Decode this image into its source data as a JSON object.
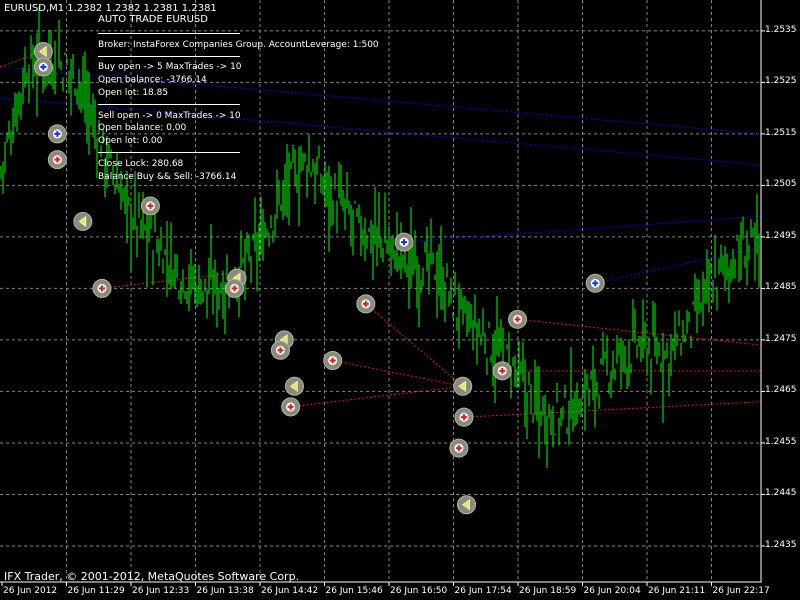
{
  "header": {
    "symbol_line": "EURUSD,M1  1.2382 1.2382 1.2381 1.2381",
    "ea_title": "AUTO TRADE EURUSD"
  },
  "info": {
    "broker": "Broker: InstaForex Companies Group. AccountLeverage: 1:500",
    "buy_open": "Buy open ->  5  MaxTrades ->  10",
    "buy_balance": "Open balance: -3766.14",
    "buy_lot": "Open lot: 18.85",
    "sell_open": "Sell open ->  0  MaxTrades ->  10",
    "sell_balance": "Open balance: 0.00",
    "sell_lot": "Open lot: 0.00",
    "close_lock": "Close Lock:  280.68",
    "balance_total": "Balance Buy && Sell: -3766.14"
  },
  "footer": "IFX Trader, © 2001-2012, MetaQuotes Software Corp.",
  "colors": {
    "background": "#000000",
    "grid": "#7f7f7f",
    "price_bars": "#00ff00",
    "buy_lines": "#0000ff",
    "sell_lines": "#ff0000",
    "text": "#ffffff"
  },
  "chart_data": {
    "type": "ohlc",
    "symbol": "EURUSD",
    "timeframe": "M1",
    "price_labels": [
      "1.2535",
      "1.2525",
      "1.2515",
      "1.2505",
      "1.2495",
      "1.2485",
      "1.2475",
      "1.2465",
      "1.2455",
      "1.2445",
      "1.2435"
    ],
    "time_labels": [
      "26 Jun 2012",
      "26 Jun 11:29",
      "26 Jun 12:33",
      "26 Jun 13:38",
      "26 Jun 14:42",
      "26 Jun 15:46",
      "26 Jun 16:50",
      "26 Jun 17:54",
      "26 Jun 18:59",
      "26 Jun 20:04",
      "26 Jun 21:11",
      "26 Jun 22:17"
    ],
    "ylim": [
      1.2428,
      1.2541
    ],
    "grid": true,
    "price_path": [
      [
        0,
        1.2508
      ],
      [
        2,
        1.2528
      ],
      [
        4,
        1.253
      ],
      [
        6,
        1.2526
      ],
      [
        8,
        1.2512
      ],
      [
        10,
        1.25
      ],
      [
        12,
        1.2494
      ],
      [
        14,
        1.2488
      ],
      [
        16,
        1.2485
      ],
      [
        18,
        1.2486
      ],
      [
        20,
        1.2492
      ],
      [
        22,
        1.2503
      ],
      [
        24,
        1.251
      ],
      [
        26,
        1.2503
      ],
      [
        28,
        1.2497
      ],
      [
        30,
        1.2494
      ],
      [
        32,
        1.249
      ],
      [
        34,
        1.2489
      ],
      [
        36,
        1.248
      ],
      [
        38,
        1.2475
      ],
      [
        40,
        1.247
      ],
      [
        42,
        1.2462
      ],
      [
        44,
        1.246
      ],
      [
        46,
        1.2465
      ],
      [
        48,
        1.247
      ],
      [
        50,
        1.2474
      ],
      [
        52,
        1.2472
      ],
      [
        54,
        1.2477
      ],
      [
        56,
        1.2487
      ],
      [
        58,
        1.2492
      ],
      [
        60,
        1.2494
      ],
      [
        62,
        1.2496
      ],
      [
        64,
        1.2487
      ],
      [
        66,
        1.247
      ],
      [
        68,
        1.2468
      ],
      [
        70,
        1.246
      ],
      [
        72,
        1.2448
      ],
      [
        74,
        1.2459
      ],
      [
        76,
        1.2466
      ],
      [
        78,
        1.2465
      ],
      [
        80,
        1.247
      ],
      [
        82,
        1.248
      ],
      [
        84,
        1.249
      ],
      [
        86,
        1.2497
      ],
      [
        88,
        1.2492
      ],
      [
        90,
        1.2495
      ],
      [
        92,
        1.249
      ],
      [
        94,
        1.2487
      ],
      [
        96,
        1.2485
      ],
      [
        98,
        1.2486
      ],
      [
        100,
        1.249
      ],
      [
        102,
        1.25
      ],
      [
        104,
        1.2495
      ],
      [
        106,
        1.2487
      ],
      [
        108,
        1.2493
      ],
      [
        110,
        1.2496
      ],
      [
        112,
        1.2495
      ],
      [
        114,
        1.2494
      ],
      [
        116,
        1.2495
      ]
    ],
    "markers": [
      {
        "t": 3.4,
        "p": 1.2531,
        "kind": "close"
      },
      {
        "t": 3.4,
        "p": 1.2528,
        "kind": "buy"
      },
      {
        "t": 4.5,
        "p": 1.2515,
        "kind": "buy"
      },
      {
        "t": 4.5,
        "p": 1.251,
        "kind": "sell"
      },
      {
        "t": 6.5,
        "p": 1.2498,
        "kind": "close"
      },
      {
        "t": 8.0,
        "p": 1.2485,
        "kind": "sell"
      },
      {
        "t": 11.8,
        "p": 1.2501,
        "kind": "sell"
      },
      {
        "t": 18.6,
        "p": 1.2487,
        "kind": "close"
      },
      {
        "t": 18.4,
        "p": 1.2485,
        "kind": "sell"
      },
      {
        "t": 22.3,
        "p": 1.2475,
        "kind": "close"
      },
      {
        "t": 22.0,
        "p": 1.2473,
        "kind": "sell"
      },
      {
        "t": 23.1,
        "p": 1.2466,
        "kind": "close"
      },
      {
        "t": 22.8,
        "p": 1.2462,
        "kind": "sell"
      },
      {
        "t": 26.1,
        "p": 1.2471,
        "kind": "sell"
      },
      {
        "t": 28.7,
        "p": 1.2482,
        "kind": "sell"
      },
      {
        "t": 31.7,
        "p": 1.2494,
        "kind": "buy"
      },
      {
        "t": 36.3,
        "p": 1.2466,
        "kind": "close"
      },
      {
        "t": 36.4,
        "p": 1.246,
        "kind": "sell"
      },
      {
        "t": 36.0,
        "p": 1.2454,
        "kind": "sell"
      },
      {
        "t": 36.6,
        "p": 1.2443,
        "kind": "close"
      },
      {
        "t": 39.4,
        "p": 1.2469,
        "kind": "sell"
      },
      {
        "t": 40.6,
        "p": 1.2479,
        "kind": "sell"
      },
      {
        "t": 46.7,
        "p": 1.2486,
        "kind": "buy"
      }
    ],
    "buy_levels": [
      {
        "from_t": 0,
        "from_p": 1.2528,
        "to_t": 59.7,
        "to_p": 1.2515
      },
      {
        "from_t": 0,
        "from_p": 1.2522,
        "to_t": 59.7,
        "to_p": 1.2509
      },
      {
        "from_t": 31.7,
        "from_p": 1.2494,
        "to_t": 59.7,
        "to_p": 1.2499
      },
      {
        "from_t": 46.7,
        "from_p": 1.2486,
        "to_t": 59.7,
        "to_p": 1.2493
      }
    ],
    "sell_levels": [
      {
        "from_t": 0,
        "from_p": 1.2528,
        "to_t": 3.4,
        "to_p": 1.2531
      },
      {
        "from_t": 8.0,
        "from_p": 1.2485,
        "to_t": 18.4,
        "to_p": 1.2488
      },
      {
        "from_t": 22.8,
        "from_p": 1.2462,
        "to_t": 36.3,
        "to_p": 1.2466
      },
      {
        "from_t": 28.7,
        "from_p": 1.2482,
        "to_t": 36.3,
        "to_p": 1.2466
      },
      {
        "from_t": 26.1,
        "from_p": 1.2471,
        "to_t": 36.3,
        "to_p": 1.2466
      },
      {
        "from_t": 36.4,
        "from_p": 1.246,
        "to_t": 59.7,
        "to_p": 1.2463
      },
      {
        "from_t": 39.4,
        "from_p": 1.2469,
        "to_t": 59.7,
        "to_p": 1.2469
      },
      {
        "from_t": 40.6,
        "from_p": 1.2479,
        "to_t": 59.7,
        "to_p": 1.2474
      }
    ]
  }
}
